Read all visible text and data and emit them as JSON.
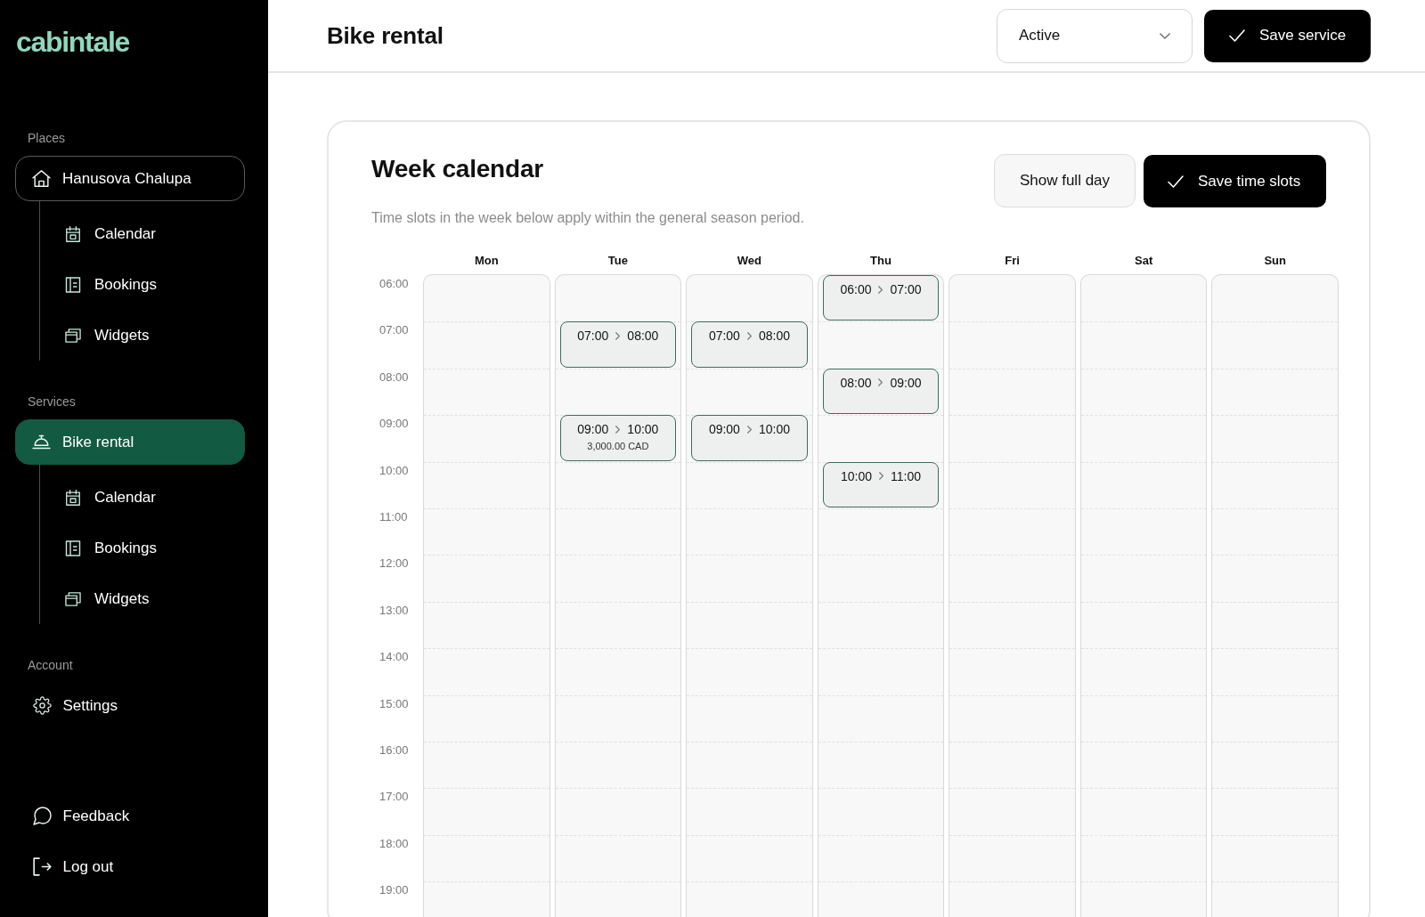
{
  "sidebar": {
    "logo": "cabintale",
    "sections": [
      {
        "heading": "Places",
        "items": [
          {
            "kind": "place",
            "label": "Hanusova Chalupa",
            "selected": false,
            "expanded": true,
            "children": [
              {
                "kind": "calendar",
                "label": "Calendar",
                "selected": false
              },
              {
                "kind": "bookings",
                "label": "Bookings",
                "selected": false
              },
              {
                "kind": "widgets",
                "label": "Widgets",
                "selected": false
              }
            ]
          }
        ]
      },
      {
        "heading": "Services",
        "items": [
          {
            "kind": "service",
            "label": "Bike rental",
            "selected": true,
            "expanded": true,
            "children": [
              {
                "kind": "calendar",
                "label": "Calendar",
                "selected": false
              },
              {
                "kind": "bookings",
                "label": "Bookings",
                "selected": false
              },
              {
                "kind": "widgets",
                "label": "Widgets",
                "selected": false
              }
            ]
          }
        ]
      },
      {
        "heading": "Account",
        "items": [
          {
            "kind": "settings",
            "label": "Settings",
            "selected": false
          }
        ]
      }
    ],
    "footer_items": [
      {
        "kind": "feedback",
        "label": "Feedback",
        "selected": false
      },
      {
        "kind": "logout",
        "label": "Log out",
        "selected": false
      }
    ]
  },
  "header": {
    "title": "Bike rental",
    "status_select": {
      "value": "Active"
    },
    "save_button": {
      "label": "Save service"
    }
  },
  "week_calendar": {
    "title": "Week calendar",
    "description": "Time slots in the week below apply within the general season period.",
    "actions": [
      {
        "kind": "toggle",
        "label": "Show full day"
      },
      {
        "kind": "save",
        "label": "Save time slots"
      }
    ],
    "hours": [
      "06:00",
      "07:00",
      "08:00",
      "09:00",
      "10:00",
      "11:00",
      "12:00",
      "13:00",
      "14:00",
      "15:00",
      "16:00",
      "17:00",
      "18:00",
      "19:00"
    ],
    "days": [
      {
        "name": "Mon"
      },
      {
        "name": "Tue",
        "slots": [
          {
            "start": "07:00",
            "end": "08:00"
          },
          {
            "start": "09:00",
            "end": "10:00",
            "price": "3,000.00 CAD"
          }
        ]
      },
      {
        "name": "Wed",
        "slots": [
          {
            "start": "07:00",
            "end": "08:00"
          },
          {
            "start": "09:00",
            "end": "10:00"
          }
        ]
      },
      {
        "name": "Thu",
        "slots": [
          {
            "start": "06:00",
            "end": "07:00"
          },
          {
            "start": "08:00",
            "end": "09:00"
          },
          {
            "start": "10:00",
            "end": "11:00"
          }
        ]
      },
      {
        "name": "Fri"
      },
      {
        "name": "Sat"
      },
      {
        "name": "Sun"
      }
    ]
  }
}
